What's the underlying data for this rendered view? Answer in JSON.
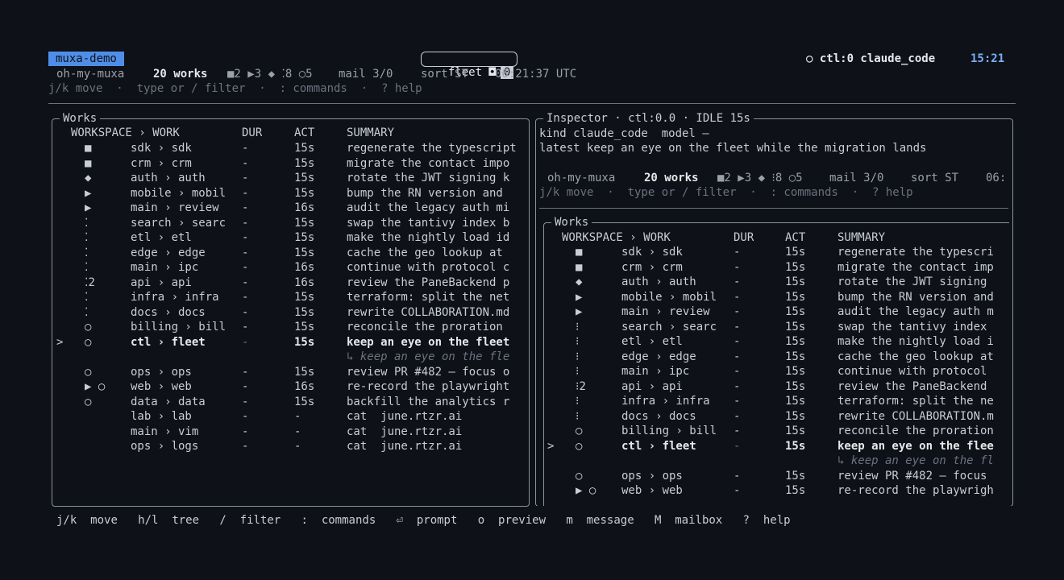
{
  "session": {
    "name": "muxa-demo",
    "fleet_label": "fleet ◘",
    "fleet_count": "0",
    "ctl": "○ ctl:0 claude_code",
    "clock": "15:21"
  },
  "status": {
    "project": "oh-my-muxa",
    "works": "20 works",
    "counts": "■2 ▶3 ◆ ⁚8 ○5",
    "mail": "mail 3/0",
    "sort": "sort ST",
    "time": "06:21:37 UTC",
    "help": "j/k move  ·  type or / filter  ·  : commands  ·  ? help"
  },
  "left_panel": {
    "title": "Works",
    "columns": [
      "WORKSPACE › WORK",
      "DUR",
      "ACT",
      "SUMMARY"
    ],
    "rows": [
      {
        "cur": "",
        "icon": "■",
        "name": "sdk › sdk",
        "dur": "-",
        "act": "15s",
        "summary": "regenerate the typescript"
      },
      {
        "cur": "",
        "icon": "■",
        "name": "crm › crm",
        "dur": "-",
        "act": "15s",
        "summary": "migrate the contact impo"
      },
      {
        "cur": "",
        "icon": "◆",
        "name": "auth › auth",
        "dur": "-",
        "act": "15s",
        "summary": "rotate the JWT signing k"
      },
      {
        "cur": "",
        "icon": "▶",
        "name": "mobile › mobil",
        "dur": "-",
        "act": "15s",
        "summary": "bump the RN version and"
      },
      {
        "cur": "",
        "icon": "▶",
        "name": "main › review",
        "dur": "-",
        "act": "16s",
        "summary": "audit the legacy auth mi"
      },
      {
        "cur": "",
        "icon": "⁚",
        "name": "search › searc",
        "dur": "-",
        "act": "15s",
        "summary": "swap the tantivy index b"
      },
      {
        "cur": "",
        "icon": "⁚",
        "name": "etl › etl",
        "dur": "-",
        "act": "15s",
        "summary": "make the nightly load id"
      },
      {
        "cur": "",
        "icon": "⁚",
        "name": "edge › edge",
        "dur": "-",
        "act": "15s",
        "summary": "cache the geo lookup at"
      },
      {
        "cur": "",
        "icon": "⁚",
        "name": "main › ipc",
        "dur": "-",
        "act": "16s",
        "summary": "continue with protocol c"
      },
      {
        "cur": "",
        "icon": "⁚2",
        "name": "api › api",
        "dur": "-",
        "act": "16s",
        "summary": "review the PaneBackend p"
      },
      {
        "cur": "",
        "icon": "⁚",
        "name": "infra › infra",
        "dur": "-",
        "act": "15s",
        "summary": "terraform: split the net"
      },
      {
        "cur": "",
        "icon": "⁚",
        "name": "docs › docs",
        "dur": "-",
        "act": "15s",
        "summary": "rewrite COLLABORATION.md"
      },
      {
        "cur": "",
        "icon": "○",
        "name": "billing › bill",
        "dur": "-",
        "act": "15s",
        "summary": "reconcile the proration"
      },
      {
        "cur": ">",
        "icon": "○",
        "name": "ctl › fleet",
        "dur": "-",
        "act": "15s",
        "summary": "keep an eye on the fleet",
        "selected": true
      },
      {
        "hint": "↳ keep an eye on the fle"
      },
      {
        "cur": "",
        "icon": "○",
        "name": "ops › ops",
        "dur": "-",
        "act": "15s",
        "summary": "review PR #482 — focus o"
      },
      {
        "cur": "",
        "icon": "▶ ○",
        "name": "web › web",
        "dur": "-",
        "act": "16s",
        "summary": "re-record the playwright"
      },
      {
        "cur": "",
        "icon": "○",
        "name": "data › data",
        "dur": "-",
        "act": "15s",
        "summary": "backfill the analytics r"
      },
      {
        "cur": "",
        "icon": "",
        "name": "lab › lab",
        "dur": "-",
        "act": "-",
        "summary": "cat  june.rtzr.ai"
      },
      {
        "cur": "",
        "icon": "",
        "name": "main › vim",
        "dur": "-",
        "act": "-",
        "summary": "cat  june.rtzr.ai"
      },
      {
        "cur": "",
        "icon": "",
        "name": "ops › logs",
        "dur": "-",
        "act": "-",
        "summary": "cat  june.rtzr.ai"
      }
    ]
  },
  "inspector": {
    "title": "Inspector · ctl:0.0 · IDLE 15s",
    "kind_line": "kind claude_code  model —",
    "latest_line": "latest keep an eye on the fleet while the migration lands",
    "status": {
      "project": "oh-my-muxa",
      "works": "20 works",
      "counts": "■2 ▶3 ◆ ⁝8 ○5",
      "mail": "mail 3/0",
      "sort": "sort ST",
      "time": "06:",
      "help": "j/k move  ·  type or / filter  ·  : commands  ·  ? help"
    },
    "works_title": "Works",
    "columns": [
      "WORKSPACE › WORK",
      "DUR",
      "ACT",
      "SUMMARY"
    ],
    "rows": [
      {
        "cur": "",
        "icon": "■",
        "name": "sdk › sdk",
        "dur": "-",
        "act": "15s",
        "summary": "regenerate the typescri"
      },
      {
        "cur": "",
        "icon": "■",
        "name": "crm › crm",
        "dur": "-",
        "act": "15s",
        "summary": "migrate the contact imp"
      },
      {
        "cur": "",
        "icon": "◆",
        "name": "auth › auth",
        "dur": "-",
        "act": "15s",
        "summary": "rotate the JWT signing"
      },
      {
        "cur": "",
        "icon": "▶",
        "name": "mobile › mobil",
        "dur": "-",
        "act": "15s",
        "summary": "bump the RN version and"
      },
      {
        "cur": "",
        "icon": "▶",
        "name": "main › review",
        "dur": "-",
        "act": "15s",
        "summary": "audit the legacy auth m"
      },
      {
        "cur": "",
        "icon": "⁝",
        "name": "search › searc",
        "dur": "-",
        "act": "15s",
        "summary": "swap the tantivy index"
      },
      {
        "cur": "",
        "icon": "⁝",
        "name": "etl › etl",
        "dur": "-",
        "act": "15s",
        "summary": "make the nightly load i"
      },
      {
        "cur": "",
        "icon": "⁝",
        "name": "edge › edge",
        "dur": "-",
        "act": "15s",
        "summary": "cache the geo lookup at"
      },
      {
        "cur": "",
        "icon": "⁝",
        "name": "main › ipc",
        "dur": "-",
        "act": "15s",
        "summary": "continue with protocol"
      },
      {
        "cur": "",
        "icon": "⁝2",
        "name": "api › api",
        "dur": "-",
        "act": "15s",
        "summary": "review the PaneBackend"
      },
      {
        "cur": "",
        "icon": "⁝",
        "name": "infra › infra",
        "dur": "-",
        "act": "15s",
        "summary": "terraform: split the ne"
      },
      {
        "cur": "",
        "icon": "⁝",
        "name": "docs › docs",
        "dur": "-",
        "act": "15s",
        "summary": "rewrite COLLABORATION.m"
      },
      {
        "cur": "",
        "icon": "○",
        "name": "billing › bill",
        "dur": "-",
        "act": "15s",
        "summary": "reconcile the proration"
      },
      {
        "cur": ">",
        "icon": "○",
        "name": "ctl › fleet",
        "dur": "-",
        "act": "15s",
        "summary": "keep an eye on the flee",
        "selected": true
      },
      {
        "hint": "↳ keep an eye on the fl"
      },
      {
        "cur": "",
        "icon": "○",
        "name": "ops › ops",
        "dur": "-",
        "act": "15s",
        "summary": "review PR #482 — focus"
      },
      {
        "cur": "",
        "icon": "▶ ○",
        "name": "web › web",
        "dur": "-",
        "act": "15s",
        "summary": "re-record the playwrigh"
      }
    ]
  },
  "footer": [
    {
      "key": "j/k",
      "label": "move"
    },
    {
      "key": "h/l",
      "label": "tree"
    },
    {
      "key": "/",
      "label": "filter"
    },
    {
      "key": ":",
      "label": "commands"
    },
    {
      "key": "⏎",
      "label": "prompt"
    },
    {
      "key": "o",
      "label": "preview"
    },
    {
      "key": "m",
      "label": "message"
    },
    {
      "key": "M",
      "label": "mailbox"
    },
    {
      "key": "?",
      "label": "help"
    }
  ]
}
